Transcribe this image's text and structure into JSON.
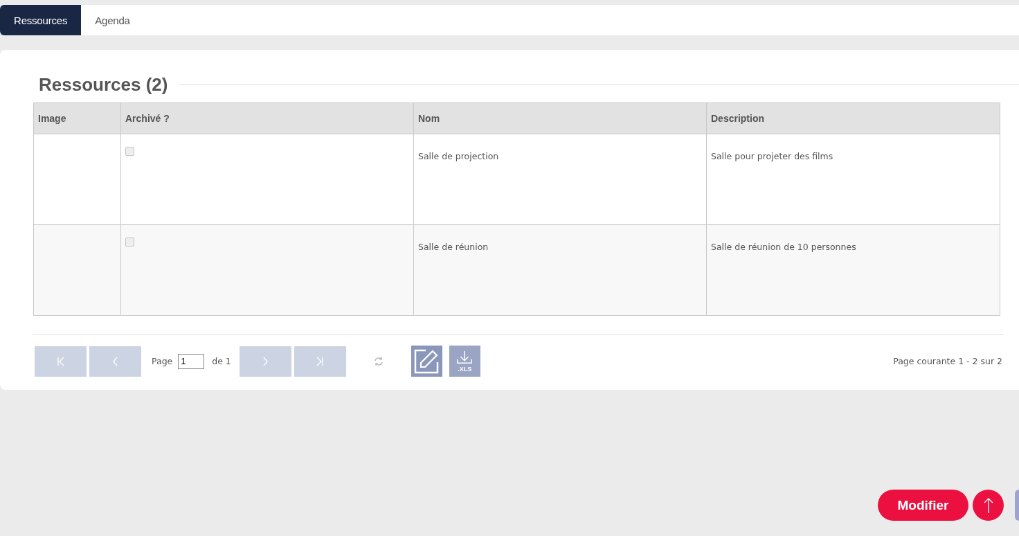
{
  "tabs": [
    {
      "label": "Ressources",
      "selected": true
    },
    {
      "label": "Agenda",
      "selected": false
    }
  ],
  "section_title": "Ressources (2)",
  "table": {
    "columns": [
      "Image",
      "Archivé ?",
      "Nom",
      "Description"
    ],
    "rows": [
      {
        "archived": false,
        "name": "Salle de projection",
        "description": "Salle pour projeter des films"
      },
      {
        "archived": false,
        "name": "Salle de réunion",
        "description": "Salle de réunion de 10 personnes"
      }
    ]
  },
  "pagination": {
    "page_label": "Page",
    "page_value": "1",
    "of_label": "de 1",
    "summary": "Page courante 1 - 2 sur 2",
    "export_label": ".XLS"
  },
  "modify_button": "Modifier"
}
